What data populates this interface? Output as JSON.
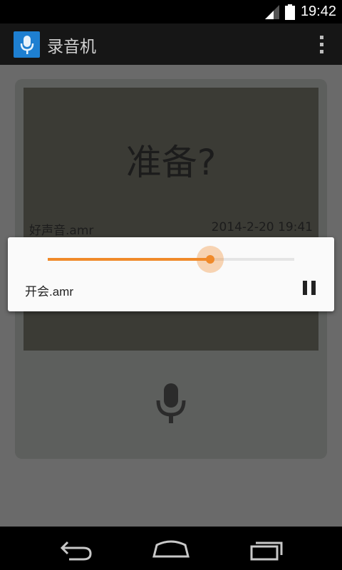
{
  "status_bar": {
    "time": "19:42",
    "icons": [
      "signal-icon",
      "battery-icon"
    ]
  },
  "action_bar": {
    "app_icon": "microphone-icon",
    "title": "录音机",
    "overflow_icon": "overflow-menu-icon"
  },
  "recorder": {
    "status_text": "准备?",
    "last_file_name": "好声音.amr",
    "last_file_date": "2014-2-20 19:41",
    "record_icon": "microphone-icon"
  },
  "player": {
    "track_name": "开会.amr",
    "progress": 0.66,
    "accent_color": "#f08a2a",
    "pause_icon": "pause-icon"
  },
  "nav_bar": {
    "buttons": [
      "back-icon",
      "home-icon",
      "recent-apps-icon"
    ]
  }
}
